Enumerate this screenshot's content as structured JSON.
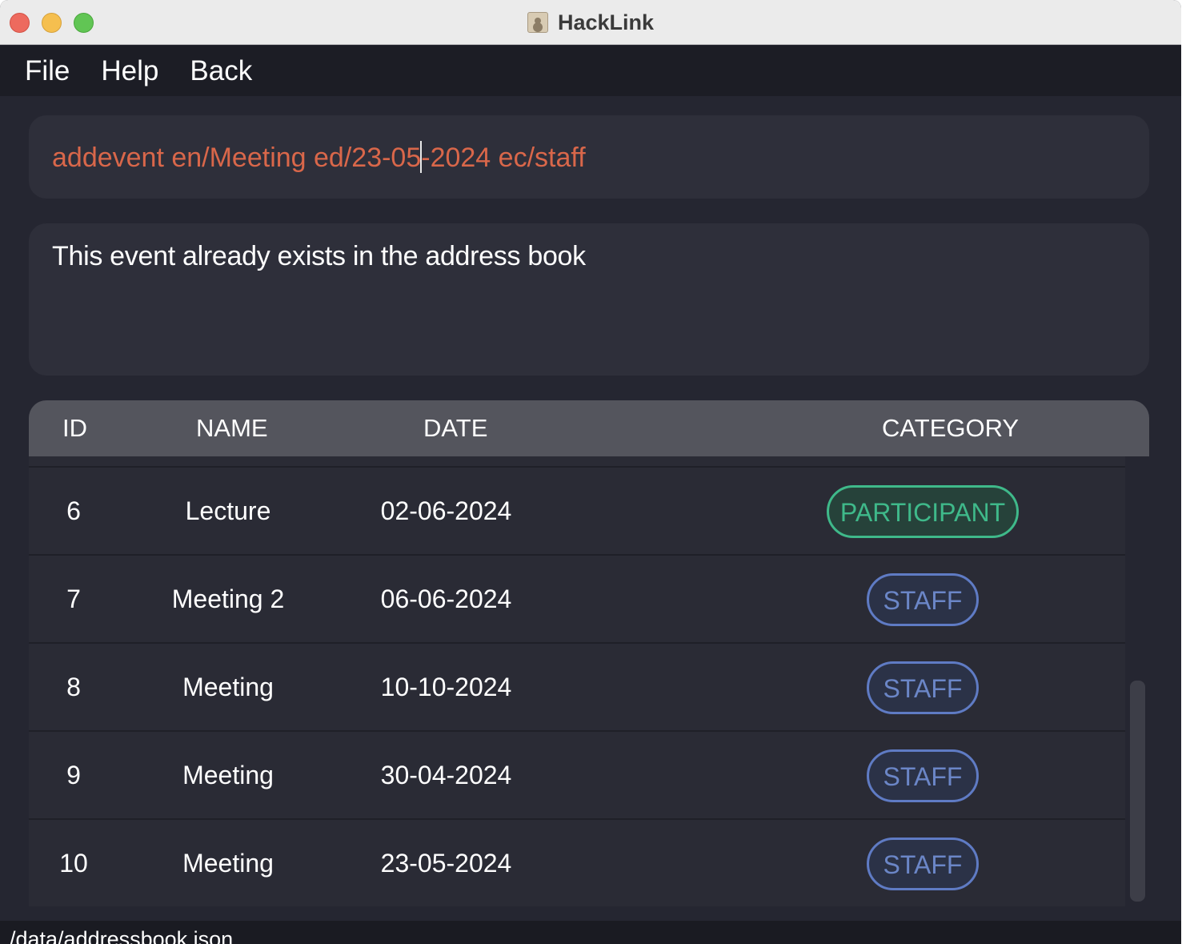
{
  "window": {
    "title": "HackLink"
  },
  "menu": [
    "File",
    "Help",
    "Back"
  ],
  "command": {
    "before_caret": "addevent en/Meeting ed/23-05",
    "after_caret": "-2024 ec/staff"
  },
  "result": {
    "message": "This event already exists in the address book"
  },
  "table": {
    "headers": {
      "id": "ID",
      "name": "NAME",
      "date": "DATE",
      "category": "CATEGORY"
    },
    "rows": [
      {
        "id": "6",
        "name": "Lecture",
        "date": "02-06-2024",
        "category": "PARTICIPANT"
      },
      {
        "id": "7",
        "name": "Meeting 2",
        "date": "06-06-2024",
        "category": "STAFF"
      },
      {
        "id": "8",
        "name": "Meeting",
        "date": "10-10-2024",
        "category": "STAFF"
      },
      {
        "id": "9",
        "name": "Meeting",
        "date": "30-04-2024",
        "category": "STAFF"
      },
      {
        "id": "10",
        "name": "Meeting",
        "date": "23-05-2024",
        "category": "STAFF"
      }
    ]
  },
  "status": {
    "path": "/data/addressbook.json"
  },
  "colors": {
    "participant": "#3fb98a",
    "staff": "#6b86c7",
    "command_text": "#d9674a",
    "background": "#252631"
  }
}
